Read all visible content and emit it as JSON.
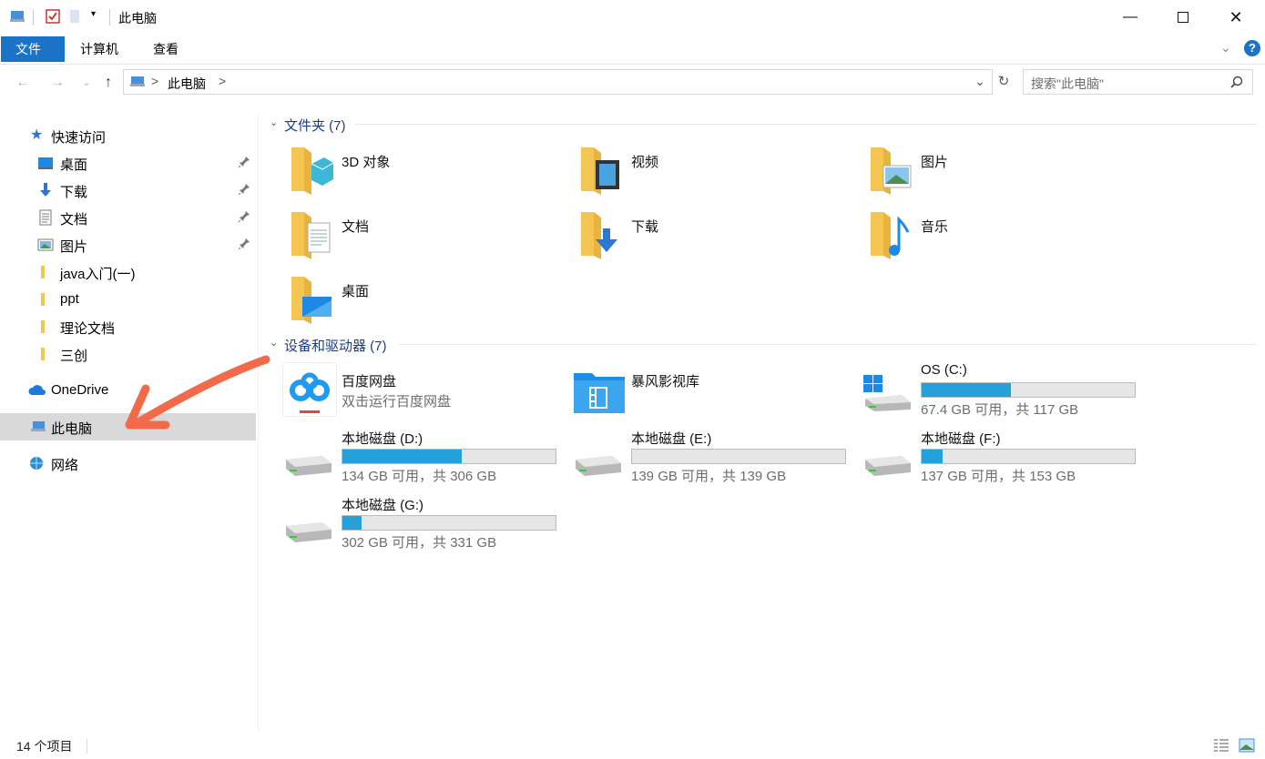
{
  "window": {
    "title": "此电脑"
  },
  "ribbon": {
    "tabs": [
      "文件",
      "计算机",
      "查看"
    ],
    "help_label": "?"
  },
  "address": {
    "root_separator": ">",
    "current": "此电脑",
    "trailing_separator": ">"
  },
  "search": {
    "placeholder": "搜索\"此电脑\""
  },
  "sidebar": {
    "items": [
      {
        "label": "快速访问"
      },
      {
        "label": "桌面"
      },
      {
        "label": "下载"
      },
      {
        "label": "文档"
      },
      {
        "label": "图片"
      },
      {
        "label": "java入门(一)"
      },
      {
        "label": "ppt"
      },
      {
        "label": "理论文档"
      },
      {
        "label": "三创"
      },
      {
        "label": "OneDrive"
      },
      {
        "label": "此电脑"
      },
      {
        "label": "网络"
      }
    ]
  },
  "folders": {
    "header": "文件夹 (7)",
    "items": [
      {
        "label": "3D 对象"
      },
      {
        "label": "视频"
      },
      {
        "label": "图片"
      },
      {
        "label": "文档"
      },
      {
        "label": "下载"
      },
      {
        "label": "音乐"
      },
      {
        "label": "桌面"
      }
    ]
  },
  "devices": {
    "header": "设备和驱动器 (7)",
    "apps": [
      {
        "label": "百度网盘",
        "subtitle": "双击运行百度网盘"
      },
      {
        "label": "暴风影视库"
      }
    ],
    "drives": [
      {
        "label": "OS (C:)",
        "subtitle": "67.4 GB 可用，共 117 GB",
        "used_fraction": 0.42
      },
      {
        "label": "本地磁盘 (D:)",
        "subtitle": "134 GB 可用，共 306 GB",
        "used_fraction": 0.56
      },
      {
        "label": "本地磁盘 (E:)",
        "subtitle": "139 GB 可用，共 139 GB",
        "used_fraction": 0.0
      },
      {
        "label": "本地磁盘 (F:)",
        "subtitle": "137 GB 可用，共 153 GB",
        "used_fraction": 0.1
      },
      {
        "label": "本地磁盘 (G:)",
        "subtitle": "302 GB 可用，共 331 GB",
        "used_fraction": 0.09
      }
    ]
  },
  "status": {
    "count": "14 个项目"
  },
  "colors": {
    "accent": "#1a73c6",
    "bar_fill": "#26a0da",
    "folder": "#f4c552",
    "annotation": "#f26a4a"
  }
}
